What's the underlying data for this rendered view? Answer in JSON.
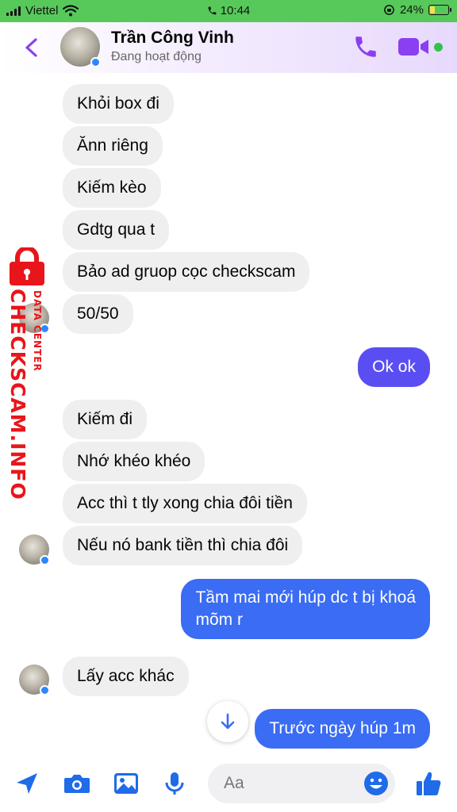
{
  "status_bar": {
    "carrier": "Viettel",
    "time": "10:44",
    "battery": "24%",
    "battery_level": 0.24
  },
  "header": {
    "contact_name": "Trần Công Vinh",
    "contact_status": "Đang hoạt động"
  },
  "messages": [
    {
      "direction": "in",
      "text": "Khỏi box đi"
    },
    {
      "direction": "in",
      "text": "Ănn riêng"
    },
    {
      "direction": "in",
      "text": "Kiếm kèo"
    },
    {
      "direction": "in",
      "text": "Gdtg qua t"
    },
    {
      "direction": "in",
      "text": "Bảo ad gruop cọc checkscam"
    },
    {
      "direction": "in",
      "text": "50/50"
    },
    {
      "direction": "out",
      "text": "Ok ok"
    },
    {
      "direction": "in",
      "text": "Kiếm đi"
    },
    {
      "direction": "in",
      "text": "Nhớ khéo khéo"
    },
    {
      "direction": "in",
      "text": "Acc thì t tly xong chia đôi tiền"
    },
    {
      "direction": "in",
      "text": "Nếu nó bank tiền thì chia đôi"
    },
    {
      "direction": "out",
      "text_line1": "Tầm mai mới húp dc t bị khoá",
      "text_line2": "mõm r"
    },
    {
      "direction": "in",
      "text": "Lấy acc khác"
    },
    {
      "direction": "out",
      "text": "Trước ngày húp 1m"
    }
  ],
  "watermark": {
    "main": "CHECKSCAM.INFO",
    "sub": "DATA CENTER"
  },
  "composer": {
    "placeholder": "Aa"
  },
  "colors": {
    "status_bar": "#57c95a",
    "accent": "#7b3fe4",
    "outgoing_purple": "#5a4ef2",
    "outgoing_blue": "#3a6cf4",
    "incoming": "#efefef",
    "watermark": "#e8151b",
    "online": "#31c24d"
  },
  "icons": [
    "back-chevron-icon",
    "phone-icon",
    "video-camera-icon",
    "location-arrow-icon",
    "camera-icon",
    "image-icon",
    "microphone-icon",
    "emoji-icon",
    "thumbs-up-icon",
    "arrow-down-icon",
    "lock-icon",
    "wifi-icon",
    "signal-icon",
    "battery-icon"
  ]
}
